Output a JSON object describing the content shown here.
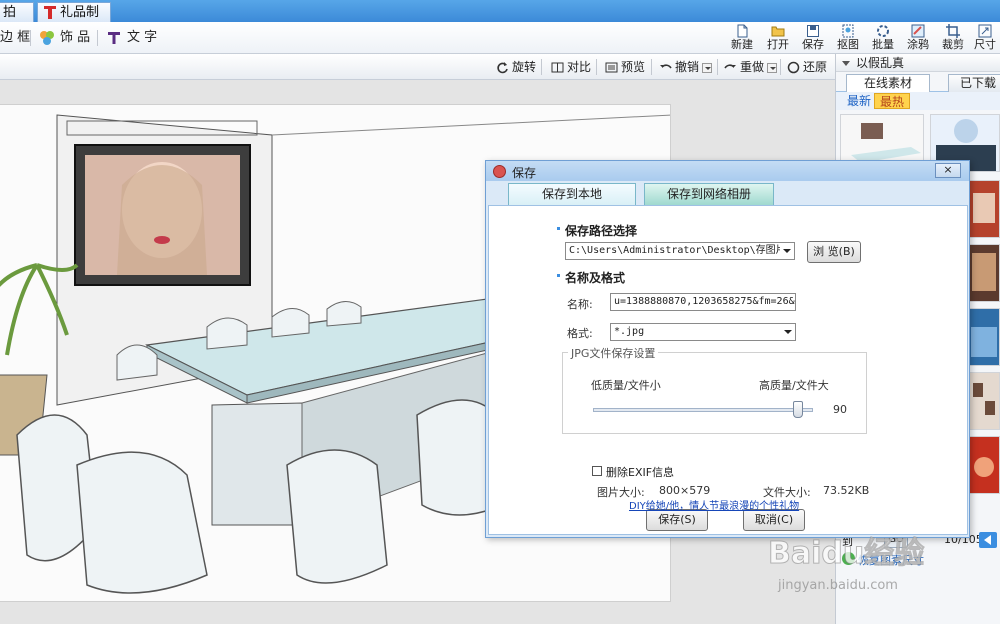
{
  "tabs": [
    {
      "label": "拍照"
    },
    {
      "label": "礼品制作"
    }
  ],
  "toolbar": {
    "frame": "边 框",
    "deco": "饰 品",
    "text": "文 字",
    "right": [
      "新建",
      "打开",
      "保存",
      "抠图",
      "批量",
      "涂鸦",
      "裁剪",
      "尺寸"
    ]
  },
  "actions": {
    "rotate": "旋转",
    "compare": "对比",
    "preview": "预览",
    "undo": "撤销",
    "redo": "重做",
    "restore": "还原"
  },
  "panel": {
    "title": "以假乱真",
    "tab_online": "在线素材",
    "tab_downloaded": "已下载",
    "sub_new": "最新",
    "sub_hot": "最热",
    "go": "GO",
    "page_count": "10/105",
    "page_label": "到",
    "reset_link": "恢复图素尺寸"
  },
  "dialog": {
    "title": "保存",
    "close": "×",
    "tab_local": "保存到本地",
    "tab_net": "保存到网络相册",
    "path_heading": "保存路径选择",
    "path_value": "C:\\Users\\Administrator\\Desktop\\存图片",
    "browse": "浏 览(B)",
    "name_heading": "名称及格式",
    "name_label": "名称:",
    "name_value": "u=1388880870,1203658275&fm=26&gp=0_",
    "format_label": "格式:",
    "format_value": "*.jpg",
    "jpg_group": "JPG文件保存设置",
    "low_quality": "低质量/文件小",
    "high_quality": "高质量/文件大",
    "quality_value": "90",
    "quality": 90,
    "exif": "删除EXIF信息",
    "img_size_label": "图片大小:",
    "img_size": "800×579",
    "file_size_label": "文件大小:",
    "file_size": "73.52KB",
    "save_btn": "保存(S)",
    "cancel_btn": "取消(C)",
    "link": "DIY给她/他，情人节最浪漫的个性礼物"
  },
  "watermark": {
    "text": "Baidu经验",
    "sub": "jingyan.baidu.com"
  },
  "colors": {
    "accent": "#3c8ad8",
    "dialog_bg": "#dbe9f7",
    "link": "#1646b8"
  }
}
